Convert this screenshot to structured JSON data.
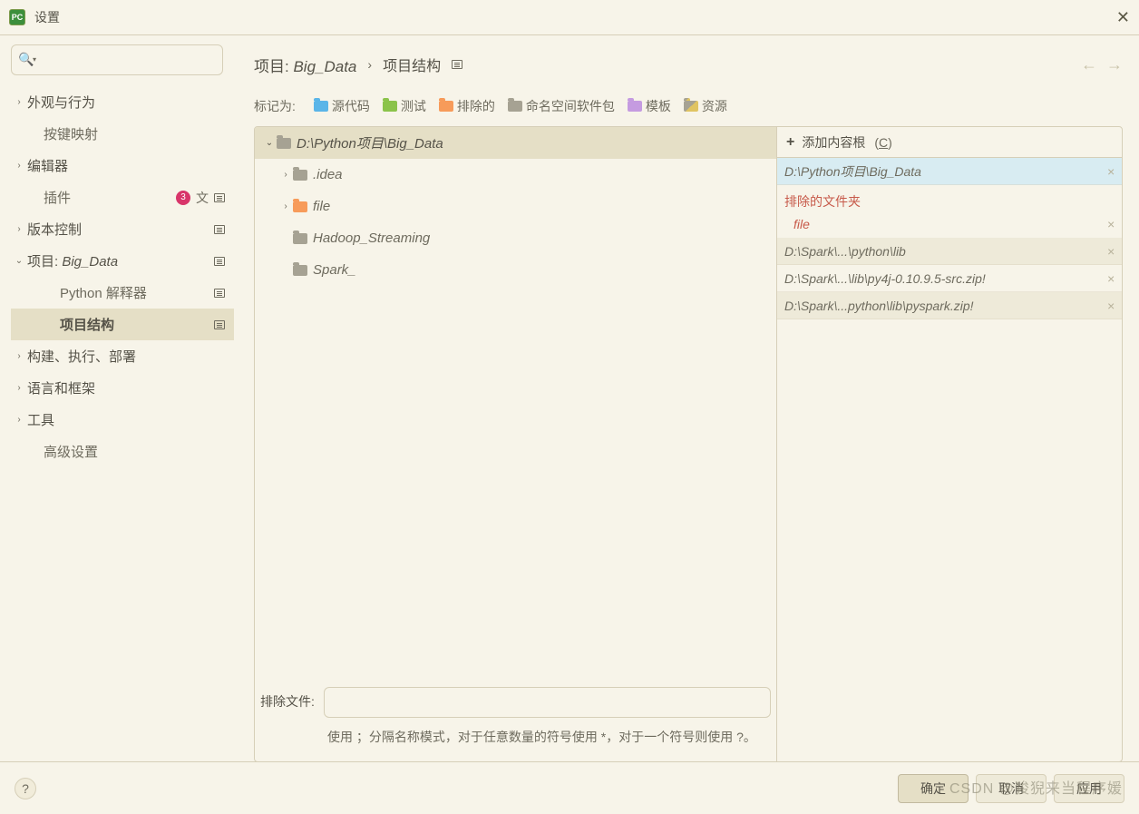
{
  "window": {
    "title": "设置"
  },
  "search": {
    "placeholder": ""
  },
  "sidebar": {
    "items": [
      {
        "label": "外观与行为",
        "expandable": true,
        "open": false,
        "level": 0
      },
      {
        "label": "按键映射",
        "expandable": false,
        "level": 1
      },
      {
        "label": "编辑器",
        "expandable": true,
        "open": false,
        "level": 0
      },
      {
        "label": "插件",
        "expandable": false,
        "level": 1,
        "badge": "3",
        "trans": true,
        "mod": true
      },
      {
        "label": "版本控制",
        "expandable": true,
        "open": false,
        "level": 0,
        "mod": true
      },
      {
        "label": "项目: Big_Data",
        "expandable": true,
        "open": true,
        "level": 0,
        "mod": true,
        "italicPart": "Big_Data",
        "prefix": "项目: "
      },
      {
        "label": "Python 解释器",
        "expandable": false,
        "level": 2,
        "mod": true
      },
      {
        "label": "项目结构",
        "expandable": false,
        "level": 2,
        "mod": true,
        "selected": true
      },
      {
        "label": "构建、执行、部署",
        "expandable": true,
        "open": false,
        "level": 0
      },
      {
        "label": "语言和框架",
        "expandable": true,
        "open": false,
        "level": 0
      },
      {
        "label": "工具",
        "expandable": true,
        "open": false,
        "level": 0
      },
      {
        "label": "高级设置",
        "expandable": false,
        "level": 1
      }
    ]
  },
  "breadcrumb": {
    "part1_prefix": "项目: ",
    "part1_italic": "Big_Data",
    "part2": "项目结构"
  },
  "marks": {
    "label": "标记为:",
    "items": [
      {
        "label": "源代码",
        "color": "fc-blue"
      },
      {
        "label": "测试",
        "color": "fc-green"
      },
      {
        "label": "排除的",
        "color": "fc-orange"
      },
      {
        "label": "命名空间软件包",
        "color": "fc-gray"
      },
      {
        "label": "模板",
        "color": "fc-purple"
      },
      {
        "label": "资源",
        "color": "fc-res"
      }
    ]
  },
  "tree": {
    "items": [
      {
        "label": "D:\\Python项目\\Big_Data",
        "level": 0,
        "open": true,
        "color": "fc-gray",
        "selected": true,
        "expandable": true
      },
      {
        "label": ".idea",
        "level": 1,
        "color": "fc-gray",
        "expandable": true,
        "open": false
      },
      {
        "label": "file",
        "level": 1,
        "color": "fc-orange",
        "expandable": true,
        "open": false
      },
      {
        "label": "Hadoop_Streaming",
        "level": 1,
        "color": "fc-gray",
        "expandable": false
      },
      {
        "label": "Spark_",
        "level": 1,
        "color": "fc-gray",
        "expandable": false
      }
    ]
  },
  "roots": {
    "add_label": "添加内容根",
    "add_hotkey": "C",
    "items": [
      {
        "label": "D:\\Python项目\\Big_Data",
        "kind": "sel"
      },
      {
        "label": "排除的文件夹",
        "kind": "cat"
      },
      {
        "label": "file",
        "kind": "sub"
      },
      {
        "label": "D:\\Spark\\...\\python\\lib",
        "kind": "gray"
      },
      {
        "label": "D:\\Spark\\...\\lib\\py4j-0.10.9.5-src.zip!",
        "kind": "plain"
      },
      {
        "label": "D:\\Spark\\...python\\lib\\pyspark.zip!",
        "kind": "gray"
      }
    ]
  },
  "exclude": {
    "label": "排除文件:",
    "value": "",
    "hint": "使用 ；分隔名称模式，对于任意数量的符号使用 *，对于一个符号则使用 ?。"
  },
  "footer": {
    "ok": "确定",
    "cancel": "取消",
    "apply": "应用"
  },
  "watermark": "CSDN @狻猊来当程序媛"
}
